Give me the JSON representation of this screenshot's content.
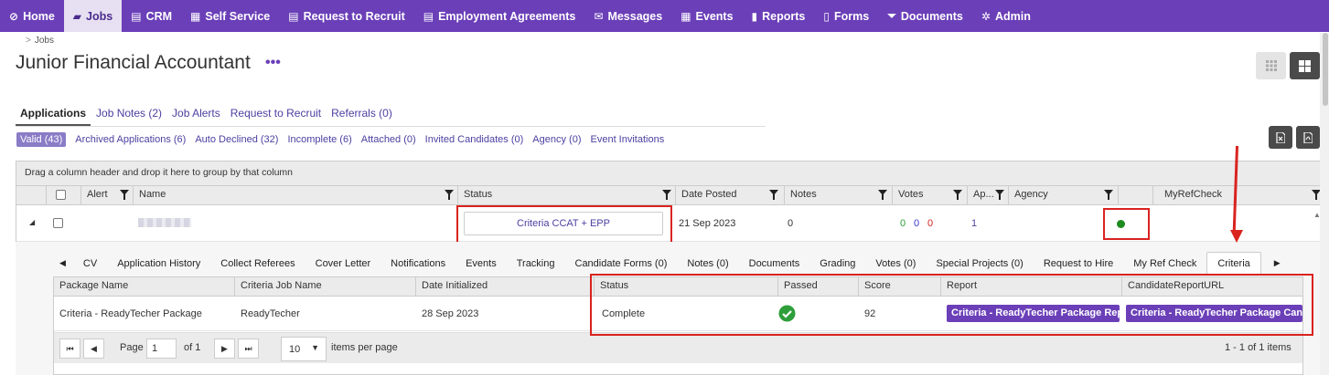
{
  "nav": {
    "items": [
      {
        "label": "Home",
        "icon": "dashboard-icon",
        "glyph": "⊘"
      },
      {
        "label": "Jobs",
        "icon": "folder-open-icon",
        "glyph": "▰"
      },
      {
        "label": "CRM",
        "icon": "briefcase-icon",
        "glyph": "▤"
      },
      {
        "label": "Self Service",
        "icon": "card-icon",
        "glyph": "▦"
      },
      {
        "label": "Request to Recruit",
        "icon": "list-icon",
        "glyph": "▤"
      },
      {
        "label": "Employment Agreements",
        "icon": "list-icon",
        "glyph": "▤"
      },
      {
        "label": "Messages",
        "icon": "envelope-icon",
        "glyph": "✉"
      },
      {
        "label": "Events",
        "icon": "calendar-icon",
        "glyph": "▦"
      },
      {
        "label": "Reports",
        "icon": "book-icon",
        "glyph": "▮"
      },
      {
        "label": "Forms",
        "icon": "file-icon",
        "glyph": "▯"
      },
      {
        "label": "Documents",
        "icon": "filter-icon",
        "glyph": "⏷"
      },
      {
        "label": "Admin",
        "icon": "cog-icon",
        "glyph": "✲"
      }
    ]
  },
  "breadcrumb": {
    "sep": ">",
    "item": "Jobs"
  },
  "page": {
    "title": "Junior Financial Accountant",
    "more": "•••"
  },
  "main_tabs": [
    "Applications",
    "Job Notes (2)",
    "Job Alerts",
    "Request to Recruit",
    "Referrals (0)"
  ],
  "sub_tabs": [
    "Valid (43)",
    "Archived Applications (6)",
    "Auto Declined (32)",
    "Incomplete (6)",
    "Attached (0)",
    "Invited Candidates (0)",
    "Agency (0)",
    "Event Invitations"
  ],
  "grid": {
    "group_hint": "Drag a column header and drop it here to group by that column",
    "columns": [
      "Alert",
      "Name",
      "Status",
      "Date Posted",
      "Notes",
      "Votes",
      "Ap...",
      "Agency",
      "MyRefCheck"
    ],
    "row": {
      "status": "Criteria CCAT + EPP",
      "date_posted": "21 Sep 2023",
      "notes": "0",
      "votes": [
        "0",
        "0",
        "0"
      ],
      "ap": "1"
    }
  },
  "detail_tabs": [
    "CV",
    "Application History",
    "Collect Referees",
    "Cover Letter",
    "Notifications",
    "Events",
    "Tracking",
    "Candidate Forms (0)",
    "Notes (0)",
    "Documents",
    "Grading",
    "Votes (0)",
    "Special Projects (0)",
    "Request to Hire",
    "My Ref Check",
    "Criteria"
  ],
  "criteria_table": {
    "columns": [
      "Package Name",
      "Criteria Job Name",
      "Date Initialized",
      "Status",
      "Passed",
      "Score",
      "Report",
      "CandidateReportURL"
    ],
    "row": {
      "package": "Criteria - ReadyTecher Package",
      "job_name": "ReadyTecher",
      "date": "28 Sep 2023",
      "status": "Complete",
      "score": "92",
      "report": "Criteria - ReadyTecher Package Report",
      "url": "Criteria - ReadyTecher Package Candidate"
    }
  },
  "pager": {
    "page_label": "Page",
    "page": "1",
    "of": "of 1",
    "per_page": "10",
    "per_page_label": "items per page",
    "summary": "1 - 1 of 1 items"
  },
  "colors": {
    "brand": "#6b3fb8",
    "annotation": "#d9231f",
    "green": "#2e9e3a"
  }
}
